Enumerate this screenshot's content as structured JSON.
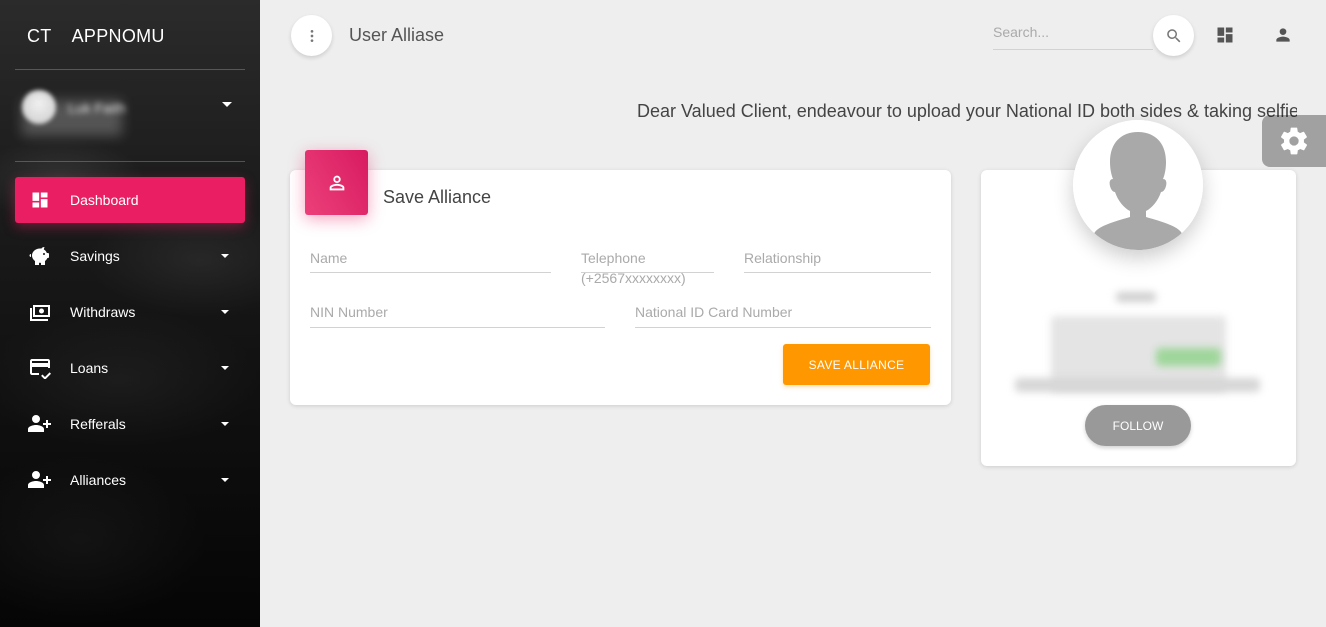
{
  "brand": {
    "short": "CT",
    "name": "APPNOMU"
  },
  "user": {
    "name": "Luk Faith"
  },
  "nav": [
    {
      "label": "Dashboard",
      "icon": "dashboard-icon",
      "active": true
    },
    {
      "label": "Savings",
      "icon": "piggy-bank-icon",
      "active": false
    },
    {
      "label": "Withdraws",
      "icon": "money-icon",
      "active": false
    },
    {
      "label": "Loans",
      "icon": "credit-card-icon",
      "active": false
    },
    {
      "label": "Refferals",
      "icon": "person-add-icon",
      "active": false
    },
    {
      "label": "Alliances",
      "icon": "person-add-icon",
      "active": false
    }
  ],
  "header": {
    "title": "User Alliase",
    "search_placeholder": "Search..."
  },
  "notice": "Dear Valued Client, endeavour to upload your National ID both sides & taking selfie pl",
  "form": {
    "title": "Save Alliance",
    "fields": {
      "name": "Name",
      "telephone": "Telephone",
      "telephone_hint": "(+2567xxxxxxxx)",
      "relationship": "Relationship",
      "nin": "NIN Number",
      "national_id": "National ID Card Number"
    },
    "submit": "SAVE ALLIANCE"
  },
  "profile": {
    "follow": "FOLLOW"
  },
  "colors": {
    "primary": "#e91e63",
    "warning": "#ff9800",
    "follow": "#999999"
  }
}
